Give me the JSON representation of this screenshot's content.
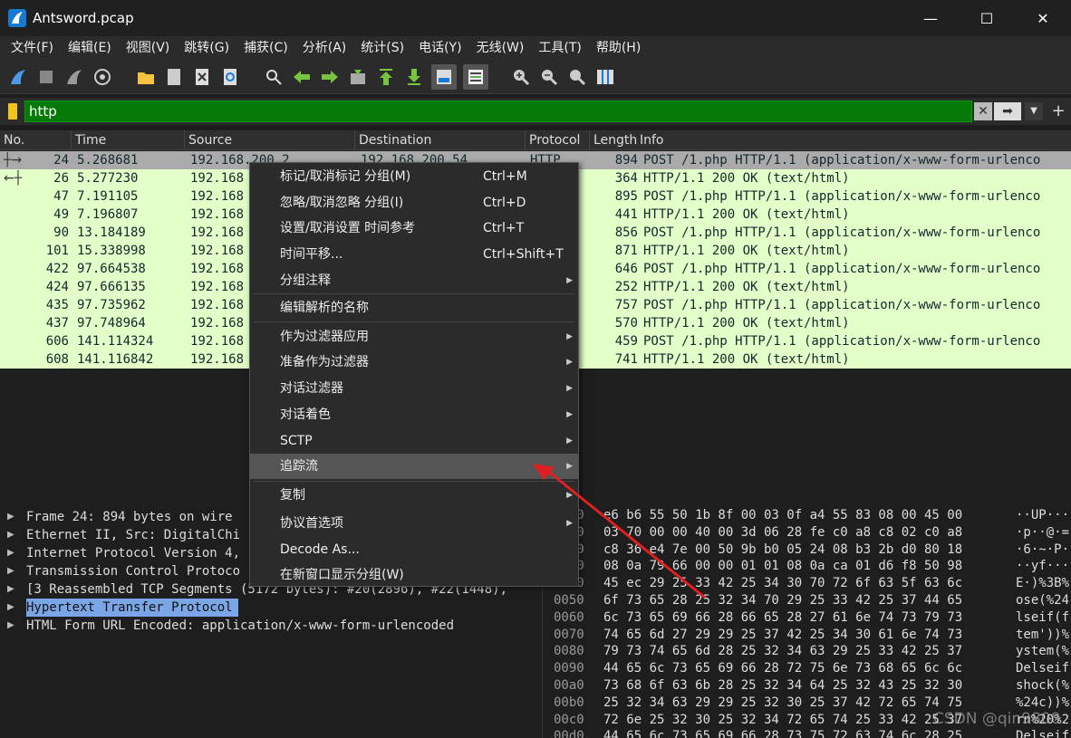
{
  "window": {
    "title": "Antsword.pcap",
    "minimize": "—",
    "maximize": "☐",
    "close": "✕"
  },
  "menubar": [
    "文件(F)",
    "编辑(E)",
    "视图(V)",
    "跳转(G)",
    "捕获(C)",
    "分析(A)",
    "统计(S)",
    "电话(Y)",
    "无线(W)",
    "工具(T)",
    "帮助(H)"
  ],
  "filter": {
    "value": "http",
    "clear": "✕",
    "apply": "➡",
    "dropdown": "▼",
    "add": "+"
  },
  "packet_list": {
    "columns": [
      "No.",
      "Time",
      "Source",
      "Destination",
      "Protocol",
      "Length",
      "Info"
    ],
    "rows": [
      {
        "no": "24",
        "time": "5.268681",
        "src": "192.168.200.2",
        "dst": "192.168.200.54",
        "proto": "HTTP",
        "len": "894",
        "info": "POST /1.php HTTP/1.1  (application/x-www-form-urlenco",
        "mark": "┼→"
      },
      {
        "no": "26",
        "time": "5.277230",
        "src": "192.168",
        "dst": "",
        "proto": "",
        "len": "364",
        "info": "HTTP/1.1 200 OK  (text/html)",
        "mark": "←┼"
      },
      {
        "no": "47",
        "time": "7.191105",
        "src": "192.168",
        "dst": "",
        "proto": "",
        "len": "895",
        "info": "POST /1.php HTTP/1.1  (application/x-www-form-urlenco",
        "mark": ""
      },
      {
        "no": "49",
        "time": "7.196807",
        "src": "192.168",
        "dst": "",
        "proto": "",
        "len": "441",
        "info": "HTTP/1.1 200 OK  (text/html)",
        "mark": ""
      },
      {
        "no": "90",
        "time": "13.184189",
        "src": "192.168",
        "dst": "",
        "proto": "",
        "len": "856",
        "info": "POST /1.php HTTP/1.1  (application/x-www-form-urlenco",
        "mark": ""
      },
      {
        "no": "101",
        "time": "15.338998",
        "src": "192.168",
        "dst": "",
        "proto": "",
        "len": "871",
        "info": "HTTP/1.1 200 OK  (text/html)",
        "mark": ""
      },
      {
        "no": "422",
        "time": "97.664538",
        "src": "192.168",
        "dst": "",
        "proto": "",
        "len": "646",
        "info": "POST /1.php HTTP/1.1  (application/x-www-form-urlenco",
        "mark": ""
      },
      {
        "no": "424",
        "time": "97.666135",
        "src": "192.168",
        "dst": "",
        "proto": "",
        "len": "252",
        "info": "HTTP/1.1 200 OK  (text/html)",
        "mark": ""
      },
      {
        "no": "435",
        "time": "97.735962",
        "src": "192.168",
        "dst": "",
        "proto": "",
        "len": "757",
        "info": "POST /1.php HTTP/1.1  (application/x-www-form-urlenco",
        "mark": ""
      },
      {
        "no": "437",
        "time": "97.748964",
        "src": "192.168",
        "dst": "",
        "proto": "",
        "len": "570",
        "info": "HTTP/1.1 200 OK  (text/html)",
        "mark": ""
      },
      {
        "no": "606",
        "time": "141.114324",
        "src": "192.168",
        "dst": "",
        "proto": "",
        "len": "459",
        "info": "POST /1.php HTTP/1.1  (application/x-www-form-urlenco",
        "mark": ""
      },
      {
        "no": "608",
        "time": "141.116842",
        "src": "192.168",
        "dst": "",
        "proto": "",
        "len": "741",
        "info": "HTTP/1.1 200 OK  (text/html)",
        "mark": ""
      }
    ]
  },
  "details": [
    "Frame 24: 894 bytes on wire",
    "Ethernet II, Src: DigitalChi",
    "Internet Protocol Version 4,",
    "Transmission Control Protoco",
    "[3 Reassembled TCP Segments (5172 bytes): #20(2896), #22(1448),",
    "Hypertext Transfer Protocol",
    "HTML Form URL Encoded: application/x-www-form-urlencoded"
  ],
  "hex": [
    {
      "off": "0000",
      "bytes": "e6 b6 55 50 1b 8f 00 03  0f a4 55 83 08 00 45 00",
      "ascii": "··UP····"
    },
    {
      "off": "0010",
      "bytes": "03 70 00 00 40 00 3d 06  28 fe c0 a8 c8 02 c0 a8",
      "ascii": "·p··@·=·"
    },
    {
      "off": "0020",
      "bytes": "c8 36 e4 7e 00 50 9b b0  05 24 08 b3 2b d0 80 18",
      "ascii": "·6·~·P··"
    },
    {
      "off": "0030",
      "bytes": "08 0a 79 66 00 00 01 01  08 0a ca 01 d6 f8 50 98",
      "ascii": "··yf····"
    },
    {
      "off": "0040",
      "bytes": "45 ec 29 25 33 42 25 34  30 70 72 6f 63 5f 63 6c",
      "ascii": "E·)%3B%"
    },
    {
      "off": "0050",
      "bytes": "6f 73 65 28 25 32 34 70  29 25 33 42 25 37 44 65",
      "ascii": "ose(%24"
    },
    {
      "off": "0060",
      "bytes": "6c 73 65 69 66 28 66 65  28 27 61 6e 74 73 79 73",
      "ascii": "lseif(f"
    },
    {
      "off": "0070",
      "bytes": "74 65 6d 27 29 29 25 37  42 25 34 30 61 6e 74 73",
      "ascii": "tem'))%"
    },
    {
      "off": "0080",
      "bytes": "79 73 74 65 6d 28 25 32  34 63 29 25 33 42 25 37",
      "ascii": "ystem(%"
    },
    {
      "off": "0090",
      "bytes": "44 65 6c 73 65 69 66 28  72 75 6e 73 68 65 6c 6c",
      "ascii": "Delseif"
    },
    {
      "off": "00a0",
      "bytes": "73 68 6f 63 6b 28 25 32  34 64 25 32 43 25 32 30",
      "ascii": "shock(%"
    },
    {
      "off": "00b0",
      "bytes": "25 32 34 63 29 29 25 32  30 25 37 42 72 65 74 75",
      "ascii": "%24c))%"
    },
    {
      "off": "00c0",
      "bytes": "72 6e 25 32 30 25 32 34  72 65 74 25 33 42 25 37",
      "ascii": "rn%20%2"
    },
    {
      "off": "00d0",
      "bytes": "44 65 6c 73 65 69 66 28  73 75 72 63 74 6c 28 25",
      "ascii": "Delseif"
    }
  ],
  "context_menu": {
    "items": [
      {
        "label": "标记/取消标记 分组(M)",
        "shortcut": "Ctrl+M",
        "submenu": false
      },
      {
        "label": "忽略/取消忽略 分组(I)",
        "shortcut": "Ctrl+D",
        "submenu": false
      },
      {
        "label": "设置/取消设置 时间参考",
        "shortcut": "Ctrl+T",
        "submenu": false
      },
      {
        "label": "时间平移...",
        "shortcut": "Ctrl+Shift+T",
        "submenu": false
      },
      {
        "label": "分组注释",
        "shortcut": "",
        "submenu": true
      },
      {
        "label": "编辑解析的名称",
        "shortcut": "",
        "submenu": false
      },
      {
        "label": "作为过滤器应用",
        "shortcut": "",
        "submenu": true
      },
      {
        "label": "准备作为过滤器",
        "shortcut": "",
        "submenu": true
      },
      {
        "label": "对话过滤器",
        "shortcut": "",
        "submenu": true
      },
      {
        "label": "对话着色",
        "shortcut": "",
        "submenu": true
      },
      {
        "label": "SCTP",
        "shortcut": "",
        "submenu": true
      },
      {
        "label": "追踪流",
        "shortcut": "",
        "submenu": true
      },
      {
        "label": "复制",
        "shortcut": "",
        "submenu": true
      },
      {
        "label": "协议首选项",
        "shortcut": "",
        "submenu": true
      },
      {
        "label": "Decode As...",
        "shortcut": "",
        "submenu": false
      },
      {
        "label": "在新窗口显示分组(W)",
        "shortcut": "",
        "submenu": false
      }
    ],
    "highlighted": "追踪流"
  },
  "watermark": "CSDN @qin9800",
  "colors": {
    "filter_valid": "#067a06",
    "row_http": "#e4ffc7",
    "highlight_detail": "#7aa5e6",
    "annotation": "#e02020"
  }
}
